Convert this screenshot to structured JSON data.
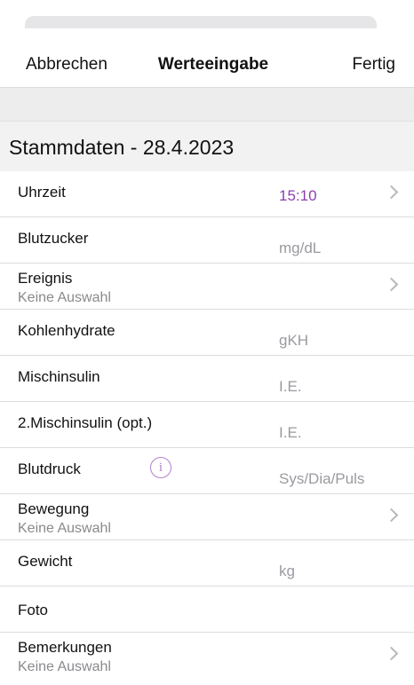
{
  "nav": {
    "cancel_label": "Abbrechen",
    "title": "Werteeingabe",
    "done_label": "Fertig"
  },
  "section": {
    "title": "Stammdaten - 28.4.2023"
  },
  "rows": [
    {
      "label": "Uhrzeit",
      "value": "15:10",
      "chevron": true
    },
    {
      "label": "Blutzucker",
      "value": "mg/dL"
    },
    {
      "label": "Ereignis",
      "subtitle": "Keine Auswahl",
      "chevron": true
    },
    {
      "label": "Kohlenhydrate",
      "value": "gKH"
    },
    {
      "label": "Mischinsulin",
      "value": "I.E."
    },
    {
      "label": "2.Mischinsulin (opt.)",
      "value": "I.E."
    },
    {
      "label": "Blutdruck",
      "value": "Sys/Dia/Puls",
      "info_icon": "i"
    },
    {
      "label": "Bewegung",
      "subtitle": "Keine Auswahl",
      "chevron": true
    },
    {
      "label": "Gewicht",
      "value": "kg"
    },
    {
      "label": "Foto"
    },
    {
      "label": "Bemerkungen",
      "subtitle": "Keine Auswahl",
      "chevron": true
    }
  ],
  "colors": {
    "accent": "#8b3fb0",
    "placeholder": "#9a9aa0",
    "background": "#f2f2f3"
  }
}
